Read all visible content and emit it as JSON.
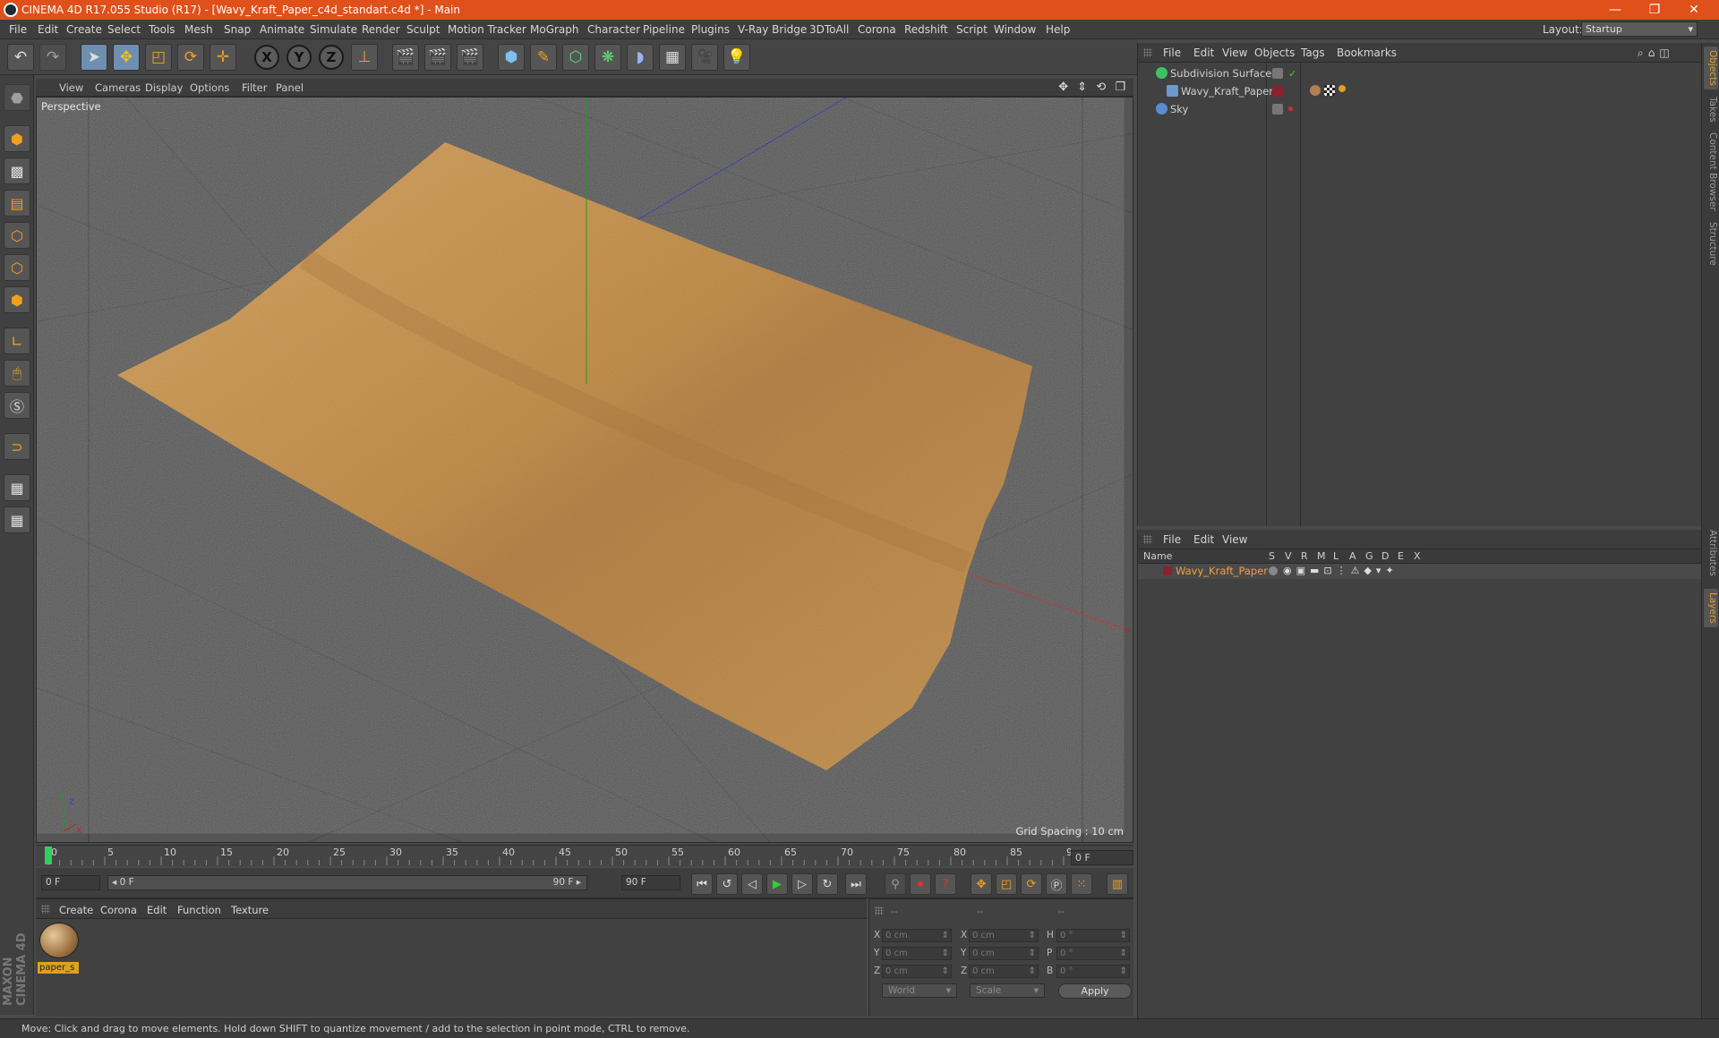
{
  "window": {
    "title": "CINEMA 4D R17.055 Studio (R17) - [Wavy_Kraft_Paper_c4d_standart.c4d *] - Main",
    "minimize": "—",
    "maximize": "❐",
    "close": "✕"
  },
  "menu": [
    "File",
    "Edit",
    "Create",
    "Select",
    "Tools",
    "Mesh",
    "Snap",
    "Animate",
    "Simulate",
    "Render",
    "Sculpt",
    "Motion Tracker",
    "MoGraph",
    "Character",
    "Pipeline",
    "Plugins",
    "V-Ray Bridge",
    "3DToAll",
    "Corona",
    "Redshift",
    "Script",
    "Window",
    "Help"
  ],
  "layout": {
    "label": "Layout:",
    "value": "Startup"
  },
  "toolbar": {
    "x_axis": "X",
    "y_axis": "Y",
    "z_axis": "Z"
  },
  "viewport": {
    "menu": [
      "View",
      "Cameras",
      "Display",
      "Options",
      "Filter",
      "Panel"
    ],
    "label": "Perspective",
    "grid_spacing": "Grid Spacing : 10 cm",
    "nav": "✥ ⇕ ⟲ ❐"
  },
  "objects_panel": {
    "menu": [
      "File",
      "Edit",
      "View",
      "Objects",
      "Tags",
      "Bookmarks"
    ],
    "items": [
      {
        "name": "Subdivision Surface"
      },
      {
        "name": "Wavy_Kraft_Paper"
      },
      {
        "name": "Sky"
      }
    ]
  },
  "layers_panel": {
    "menu": [
      "File",
      "Edit",
      "View"
    ],
    "columns": [
      "Name",
      "S",
      "V",
      "R",
      "M",
      "L",
      "A",
      "G",
      "D",
      "E",
      "X"
    ],
    "row": {
      "name": "Wavy_Kraft_Paper"
    }
  },
  "side_tabs": [
    "Objects",
    "Takes",
    "Content Browser",
    "Structure",
    "Attributes",
    "Layers"
  ],
  "timeline": {
    "ticks": [
      "0",
      "5",
      "10",
      "15",
      "20",
      "25",
      "30",
      "35",
      "40",
      "45",
      "50",
      "55",
      "60",
      "65",
      "70",
      "75",
      "80",
      "85",
      "90"
    ],
    "end_frame": "0 F",
    "current": "0 F",
    "range_start": "◂ 0 F",
    "range_end": "90 F ▸",
    "max": "90 F"
  },
  "materials": {
    "menu": [
      "Create",
      "Corona",
      "Edit",
      "Function",
      "Texture"
    ],
    "items": [
      {
        "name": "paper_s"
      }
    ]
  },
  "coords": {
    "headers": [
      "--",
      "--",
      "--"
    ],
    "rows": [
      {
        "a": "X",
        "av": "0 cm",
        "b": "X",
        "bv": "0 cm",
        "c": "H",
        "cv": "0 °"
      },
      {
        "a": "Y",
        "av": "0 cm",
        "b": "Y",
        "bv": "0 cm",
        "c": "P",
        "cv": "0 °"
      },
      {
        "a": "Z",
        "av": "0 cm",
        "b": "Z",
        "bv": "0 cm",
        "c": "B",
        "cv": "0 °"
      }
    ],
    "space": "World",
    "mode": "Scale",
    "apply": "Apply"
  },
  "status": "Move: Click and drag to move elements. Hold down SHIFT to quantize movement / add to the selection in point mode, CTRL to remove.",
  "brand": "MAXON CINEMA 4D",
  "colors": {
    "titlebar": "#e0501a",
    "accent": "#e0a020",
    "viewport": "#555555"
  }
}
